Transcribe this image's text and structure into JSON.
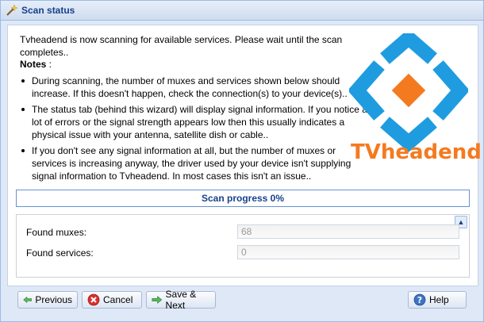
{
  "window": {
    "title": "Scan status",
    "title_icon": "wand-icon"
  },
  "intro": "Tvheadend is now scanning for available services. Please wait until the scan completes..",
  "notes": {
    "heading": "Notes",
    "heading_suffix": " :",
    "items": [
      "During scanning, the number of muxes and services shown below should increase. If this doesn't happen, check the connection(s) to your device(s)..",
      "The status tab (behind this wizard) will display signal information. If you notice a lot of errors or the signal strength appears low then this usually indicates a physical issue with your antenna, satellite dish or cable..",
      "If you don't see any signal information at all, but the number of muxes or services is increasing anyway, the driver used by your device isn't supplying signal information to Tvheadend. In most cases this isn't an issue.."
    ]
  },
  "logo": {
    "text": "TVheadend",
    "colors": {
      "blue": "#1f9ce0",
      "orange": "#f47a20"
    }
  },
  "progress": {
    "label": "Scan progress 0%",
    "percent": 0
  },
  "stats": {
    "collapse_icon": "chevron-up-icon",
    "fields": [
      {
        "label": "Found muxes:",
        "value": "68"
      },
      {
        "label": "Found services:",
        "value": "0"
      }
    ]
  },
  "buttons": {
    "previous": {
      "label": "Previous",
      "icon": "arrow-left-icon"
    },
    "cancel": {
      "label": "Cancel",
      "icon": "cancel-icon"
    },
    "save_next": {
      "label": "Save & Next",
      "icon": "arrow-right-icon"
    },
    "help": {
      "label": "Help",
      "icon": "help-icon"
    }
  }
}
